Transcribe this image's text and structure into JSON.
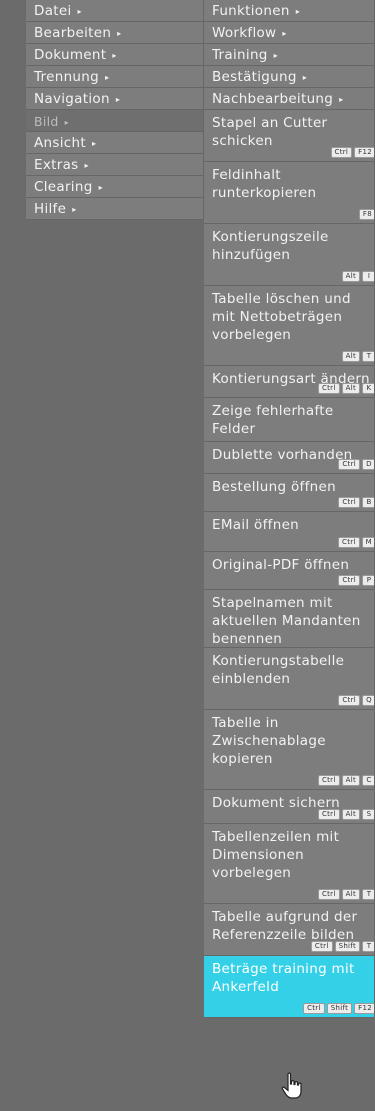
{
  "left_menu": [
    {
      "label": "Datei",
      "arrow": "▸",
      "state": "normal"
    },
    {
      "label": "Bearbeiten",
      "arrow": "▸",
      "state": "normal"
    },
    {
      "label": "Dokument",
      "arrow": "▸",
      "state": "normal"
    },
    {
      "label": "Trennung",
      "arrow": "▸",
      "state": "normal"
    },
    {
      "label": "Navigation",
      "arrow": "▸",
      "state": "normal"
    },
    {
      "label": "Bild",
      "arrow": "▸",
      "state": "disabled"
    },
    {
      "label": "Ansicht",
      "arrow": "▸",
      "state": "normal"
    },
    {
      "label": "Extras",
      "arrow": "▸",
      "state": "normal"
    },
    {
      "label": "Clearing",
      "arrow": "▸",
      "state": "normal"
    },
    {
      "label": "Hilfe",
      "arrow": "▸",
      "state": "normal"
    }
  ],
  "right_menu": [
    {
      "label": "Funktionen",
      "arrow": "▸",
      "keys": []
    },
    {
      "label": "Workflow",
      "arrow": "▸",
      "keys": []
    },
    {
      "label": "Training",
      "arrow": "▸",
      "keys": []
    },
    {
      "label": "Bestätigung",
      "arrow": "▸",
      "keys": []
    },
    {
      "label": "Nachbearbeitung",
      "arrow": "▸",
      "keys": []
    },
    {
      "label": "Stapel an Cutter schicken",
      "keys": [
        "Ctrl",
        "F12"
      ]
    },
    {
      "label": "Feldinhalt runterkopieren",
      "keys": [
        "F8"
      ]
    },
    {
      "label": "Kontierungszeile hinzufügen",
      "keys": [
        "Alt",
        "I"
      ]
    },
    {
      "label": "Tabelle löschen und mit Nettobeträgen vorbelegen",
      "keys": [
        "Alt",
        "T"
      ]
    },
    {
      "label": "Kontierungsart ändern",
      "keys": [
        "Ctrl",
        "Alt",
        "K"
      ]
    },
    {
      "label": "Zeige fehlerhafte Felder",
      "keys": []
    },
    {
      "label": "Dublette vorhanden",
      "keys": [
        "Ctrl",
        "D"
      ]
    },
    {
      "label": "Bestellung öffnen",
      "keys": [
        "Ctrl",
        "B"
      ]
    },
    {
      "label": "EMail öffnen",
      "keys": [
        "Ctrl",
        "M"
      ]
    },
    {
      "label": "Original-PDF öffnen",
      "keys": [
        "Ctrl",
        "P"
      ]
    },
    {
      "label": "Stapelnamen mit aktuellen Mandanten benennen",
      "keys": []
    },
    {
      "label": "Kontierungstabelle einblenden",
      "keys": [
        "Ctrl",
        "Q"
      ]
    },
    {
      "label": "Tabelle in Zwischenablage kopieren",
      "keys": [
        "Ctrl",
        "Alt",
        "C"
      ]
    },
    {
      "label": "Dokument sichern",
      "keys": [
        "Ctrl",
        "Alt",
        "S"
      ]
    },
    {
      "label": "Tabellenzeilen mit Dimensionen vorbelegen",
      "keys": [
        "Ctrl",
        "Alt",
        "T"
      ]
    },
    {
      "label": "Tabelle aufgrund der Referenzzeile bilden",
      "keys": [
        "Ctrl",
        "Shift",
        "T"
      ]
    },
    {
      "label": "Beträge training mit Ankerfeld",
      "keys": [
        "Ctrl",
        "Shift",
        "F12"
      ],
      "state": "active"
    }
  ],
  "colors": {
    "background": "#6b6b6b",
    "item": "#7d7d7d",
    "active": "#34d0e8",
    "text": "#f2f2f2"
  },
  "icons": {
    "cursor": "hand-pointer-icon"
  }
}
